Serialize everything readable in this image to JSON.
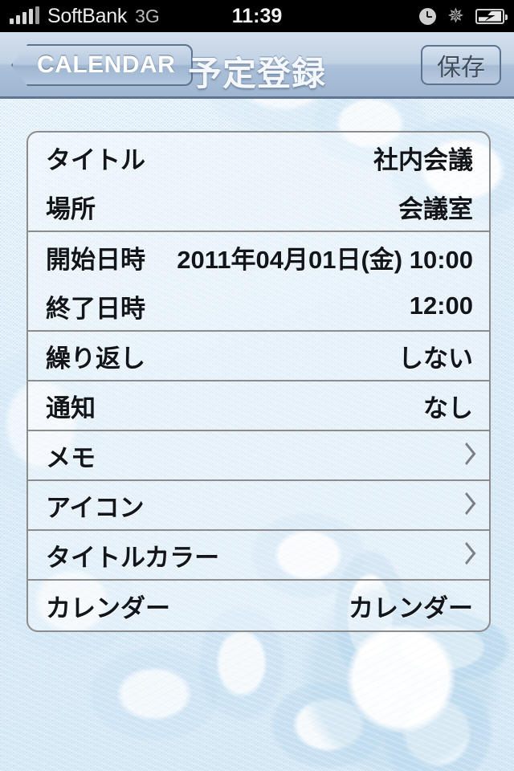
{
  "status_bar": {
    "carrier": "SoftBank",
    "network": "3G",
    "time": "11:39",
    "signal_bars": 5,
    "icons": [
      "signal-bars-icon",
      "alarm-clock-icon",
      "bluetooth-icon",
      "battery-charging-icon"
    ]
  },
  "nav_bar": {
    "back_label": "CALENDAR",
    "title": "予定登録",
    "save_label": "保存"
  },
  "form": {
    "rows": [
      {
        "label": "タイトル",
        "value": "社内会議",
        "accessory": "none",
        "separator": false
      },
      {
        "label": "場所",
        "value": "会議室",
        "accessory": "none",
        "separator": true
      },
      {
        "label": "開始日時",
        "value": "2011年04月01日(金) 10:00",
        "accessory": "none",
        "separator": false
      },
      {
        "label": "終了日時",
        "value": "12:00",
        "accessory": "none",
        "separator": true
      },
      {
        "label": "繰り返し",
        "value": "しない",
        "accessory": "none",
        "separator": true
      },
      {
        "label": "通知",
        "value": "なし",
        "accessory": "none",
        "separator": true
      },
      {
        "label": "メモ",
        "value": "",
        "accessory": "chevron",
        "separator": true
      },
      {
        "label": "アイコン",
        "value": "",
        "accessory": "chevron",
        "separator": true
      },
      {
        "label": "タイトルカラー",
        "value": "",
        "accessory": "chevron",
        "separator": true
      },
      {
        "label": "カレンダー",
        "value": "カレンダー",
        "accessory": "none",
        "separator": false
      }
    ]
  },
  "colors": {
    "nav_top": "#d3dfed",
    "nav_bottom": "#9fb6d1",
    "nav_border": "#5f7490",
    "table_border": "#8c8c8c",
    "text": "#12161a",
    "chevron": "#7b7f85",
    "wallpaper": "#eaf4fb",
    "status_bar_bg": "#000000"
  }
}
